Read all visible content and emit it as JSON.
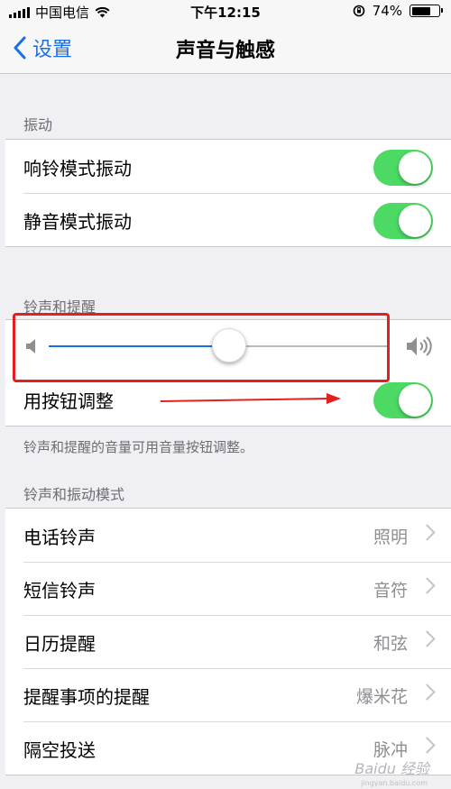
{
  "status_bar": {
    "carrier": "中国电信",
    "time": "下午12:15",
    "battery_text": "74%",
    "battery_level": 0.74
  },
  "nav": {
    "back_label": "设置",
    "title": "声音与触感"
  },
  "vibration": {
    "header": "振动",
    "items": [
      {
        "label": "响铃模式振动",
        "on": true
      },
      {
        "label": "静音模式振动",
        "on": true
      }
    ]
  },
  "ringer": {
    "header": "铃声和提醒",
    "volume_level": 0.53,
    "change_with_buttons": {
      "label": "用按钮调整",
      "on": true
    },
    "footer": "铃声和提醒的音量可用音量按钮调整。"
  },
  "sounds": {
    "header": "铃声和振动模式",
    "items": [
      {
        "label": "电话铃声",
        "value": "照明"
      },
      {
        "label": "短信铃声",
        "value": "音符"
      },
      {
        "label": "日历提醒",
        "value": "和弦"
      },
      {
        "label": "提醒事项的提醒",
        "value": "爆米花"
      },
      {
        "label": "隔空投送",
        "value": "脉冲"
      }
    ]
  },
  "watermark": {
    "text": "Baidu 经验",
    "sub": "jingyan.baidu.com"
  },
  "colors": {
    "accent": "#1a6ee6",
    "toggle_on": "#4cd964",
    "annotation": "#e41f1f",
    "background": "#efeff4"
  },
  "icons": {
    "signal": "cellular-signal-icon",
    "wifi": "wifi-icon",
    "rotation_lock": "rotation-lock-icon",
    "battery": "battery-icon",
    "back": "chevron-left-icon",
    "volume_low": "speaker-low-icon",
    "volume_high": "speaker-high-icon"
  }
}
